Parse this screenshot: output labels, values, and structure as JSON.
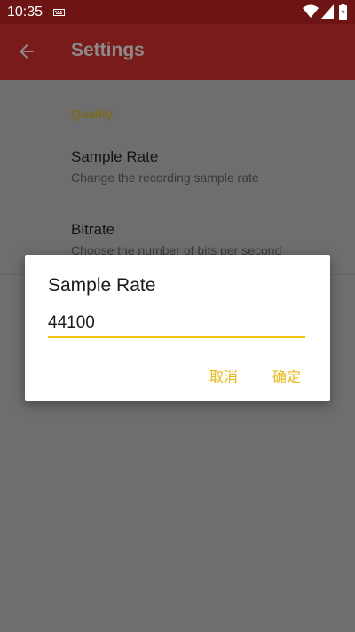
{
  "status_bar": {
    "time": "10:35",
    "icons": [
      "keyboard-icon",
      "wifi-icon",
      "signal-icon",
      "battery-icon"
    ]
  },
  "app_bar": {
    "title": "Settings",
    "back_icon": "arrow-back-icon"
  },
  "settings": {
    "section_header": "Quality",
    "items": [
      {
        "title": "Sample Rate",
        "summary": "Change the recording sample rate"
      },
      {
        "title": "Bitrate",
        "summary": "Choose the number of bits per second"
      }
    ]
  },
  "dialog": {
    "title": "Sample Rate",
    "input_value": "44100",
    "cancel_label": "取消",
    "ok_label": "确定"
  },
  "colors": {
    "accent": "#f3c013",
    "primary_dark": "#6e1414",
    "primary": "#7a1b1b",
    "scrim": "#6e6e6e"
  }
}
